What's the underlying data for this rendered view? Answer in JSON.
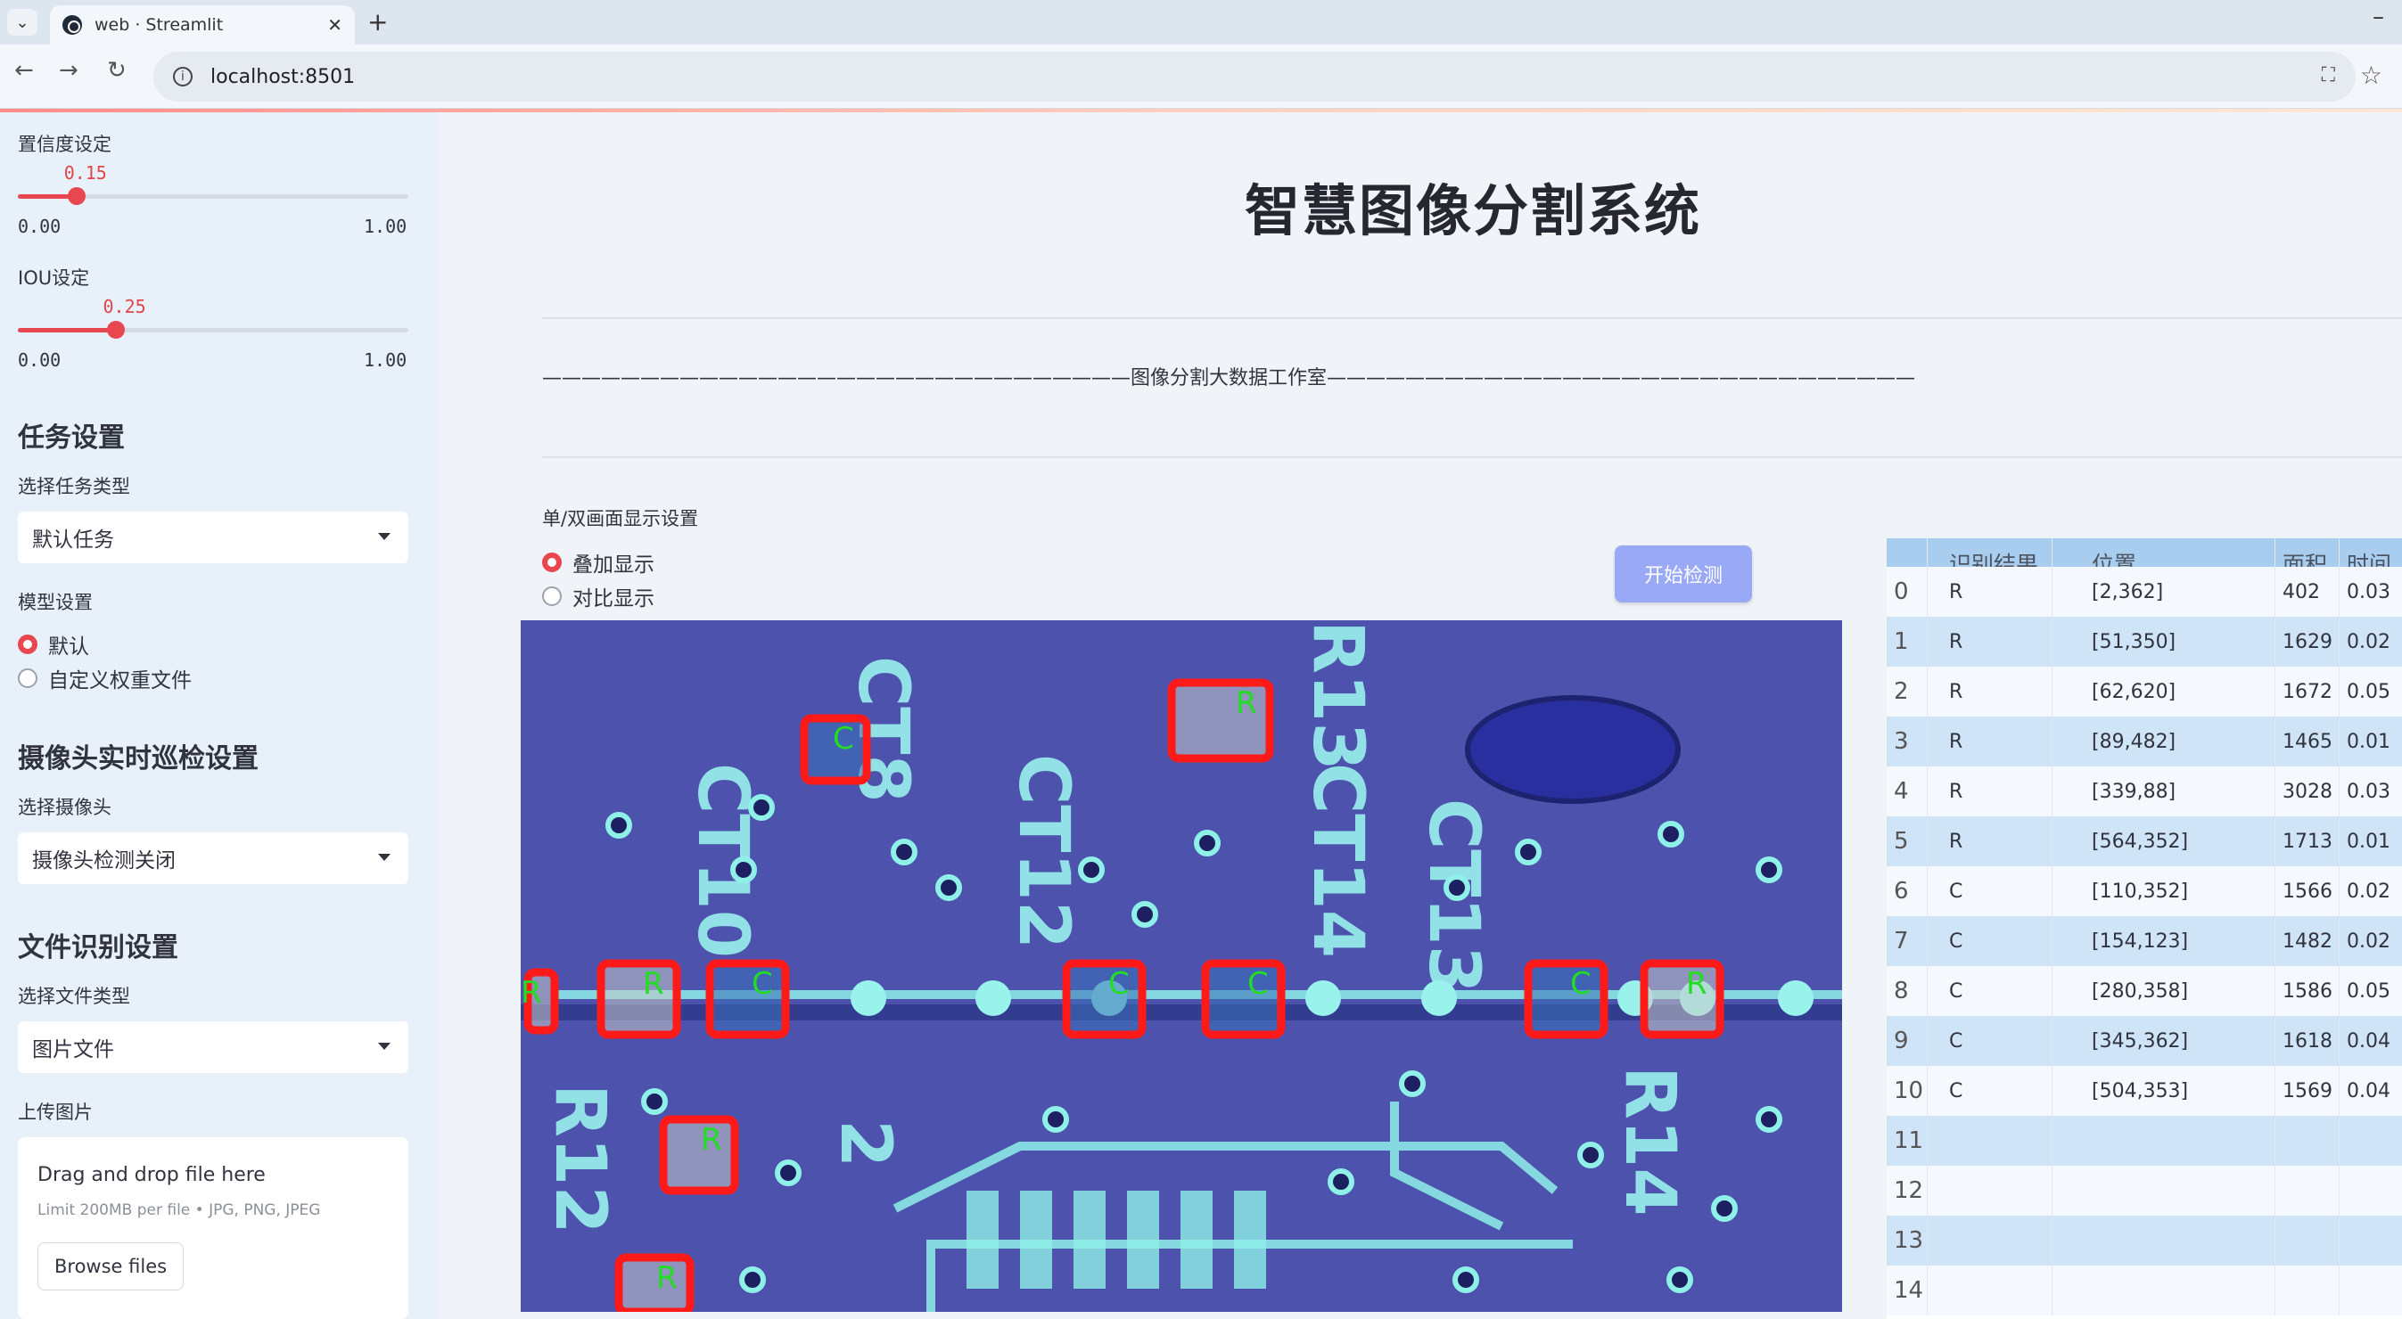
{
  "browser": {
    "tab_title": "web · Streamlit",
    "tab_close": "✕",
    "new_tab": "+",
    "url": "localhost:8501"
  },
  "sidebar": {
    "confidence": {
      "label": "置信度设定",
      "value": "0.15",
      "value_num": 0.15,
      "min": "0.00",
      "max": "1.00"
    },
    "iou": {
      "label": "IOU设定",
      "value": "0.25",
      "value_num": 0.25,
      "min": "0.00",
      "max": "1.00"
    },
    "task_section": "任务设置",
    "task_type_label": "选择任务类型",
    "task_type_value": "默认任务",
    "model_label": "模型设置",
    "model_options": [
      "默认",
      "自定义权重文件"
    ],
    "model_selected": 0,
    "camera_section": "摄像头实时巡检设置",
    "camera_label": "选择摄像头",
    "camera_value": "摄像头检测关闭",
    "file_section": "文件识别设置",
    "file_type_label": "选择文件类型",
    "file_type_value": "图片文件",
    "upload_label": "上传图片",
    "upload_drag": "Drag and drop file here",
    "upload_limit": "Limit 200MB per file • JPG, PNG, JPEG",
    "browse_button": "Browse files"
  },
  "main": {
    "title": "智慧图像分割系统",
    "banner": "——————————————————————————————图像分割大数据工作室——————————————————————————————",
    "display_label": "单/双画面显示设置",
    "display_options": [
      "叠加显示",
      "对比显示"
    ],
    "display_selected": 0,
    "start_button": "开始检测"
  },
  "table": {
    "columns": [
      "",
      "识别结果",
      "位置",
      "面积",
      "时间"
    ],
    "rows": [
      [
        "0",
        "R",
        "[2,362]",
        "402",
        "0.03"
      ],
      [
        "1",
        "R",
        "[51,350]",
        "1629",
        "0.02"
      ],
      [
        "2",
        "R",
        "[62,620]",
        "1672",
        "0.05"
      ],
      [
        "3",
        "R",
        "[89,482]",
        "1465",
        "0.01"
      ],
      [
        "4",
        "R",
        "[339,88]",
        "3028",
        "0.03"
      ],
      [
        "5",
        "R",
        "[564,352]",
        "1713",
        "0.01"
      ],
      [
        "6",
        "C",
        "[110,352]",
        "1566",
        "0.02"
      ],
      [
        "7",
        "C",
        "[154,123]",
        "1482",
        "0.02"
      ],
      [
        "8",
        "C",
        "[280,358]",
        "1586",
        "0.05"
      ],
      [
        "9",
        "C",
        "[345,362]",
        "1618",
        "0.04"
      ],
      [
        "10",
        "C",
        "[504,353]",
        "1569",
        "0.04"
      ],
      [
        "11",
        "",
        "",
        "",
        ""
      ],
      [
        "12",
        "",
        "",
        "",
        ""
      ],
      [
        "13",
        "",
        "",
        "",
        ""
      ],
      [
        "14",
        "",
        "",
        "",
        ""
      ]
    ]
  },
  "detections": [
    {
      "label": "C"
    },
    {
      "label": "R"
    },
    {
      "label": "R"
    },
    {
      "label": "R"
    },
    {
      "label": "C"
    },
    {
      "label": "C"
    },
    {
      "label": "C"
    },
    {
      "label": "C"
    },
    {
      "label": "R"
    },
    {
      "label": "R"
    },
    {
      "label": "R"
    }
  ],
  "colors": {
    "accent": "#e8474f",
    "box": "#ff1a1a",
    "label": "#22dd22",
    "board": "#4e55b0"
  }
}
